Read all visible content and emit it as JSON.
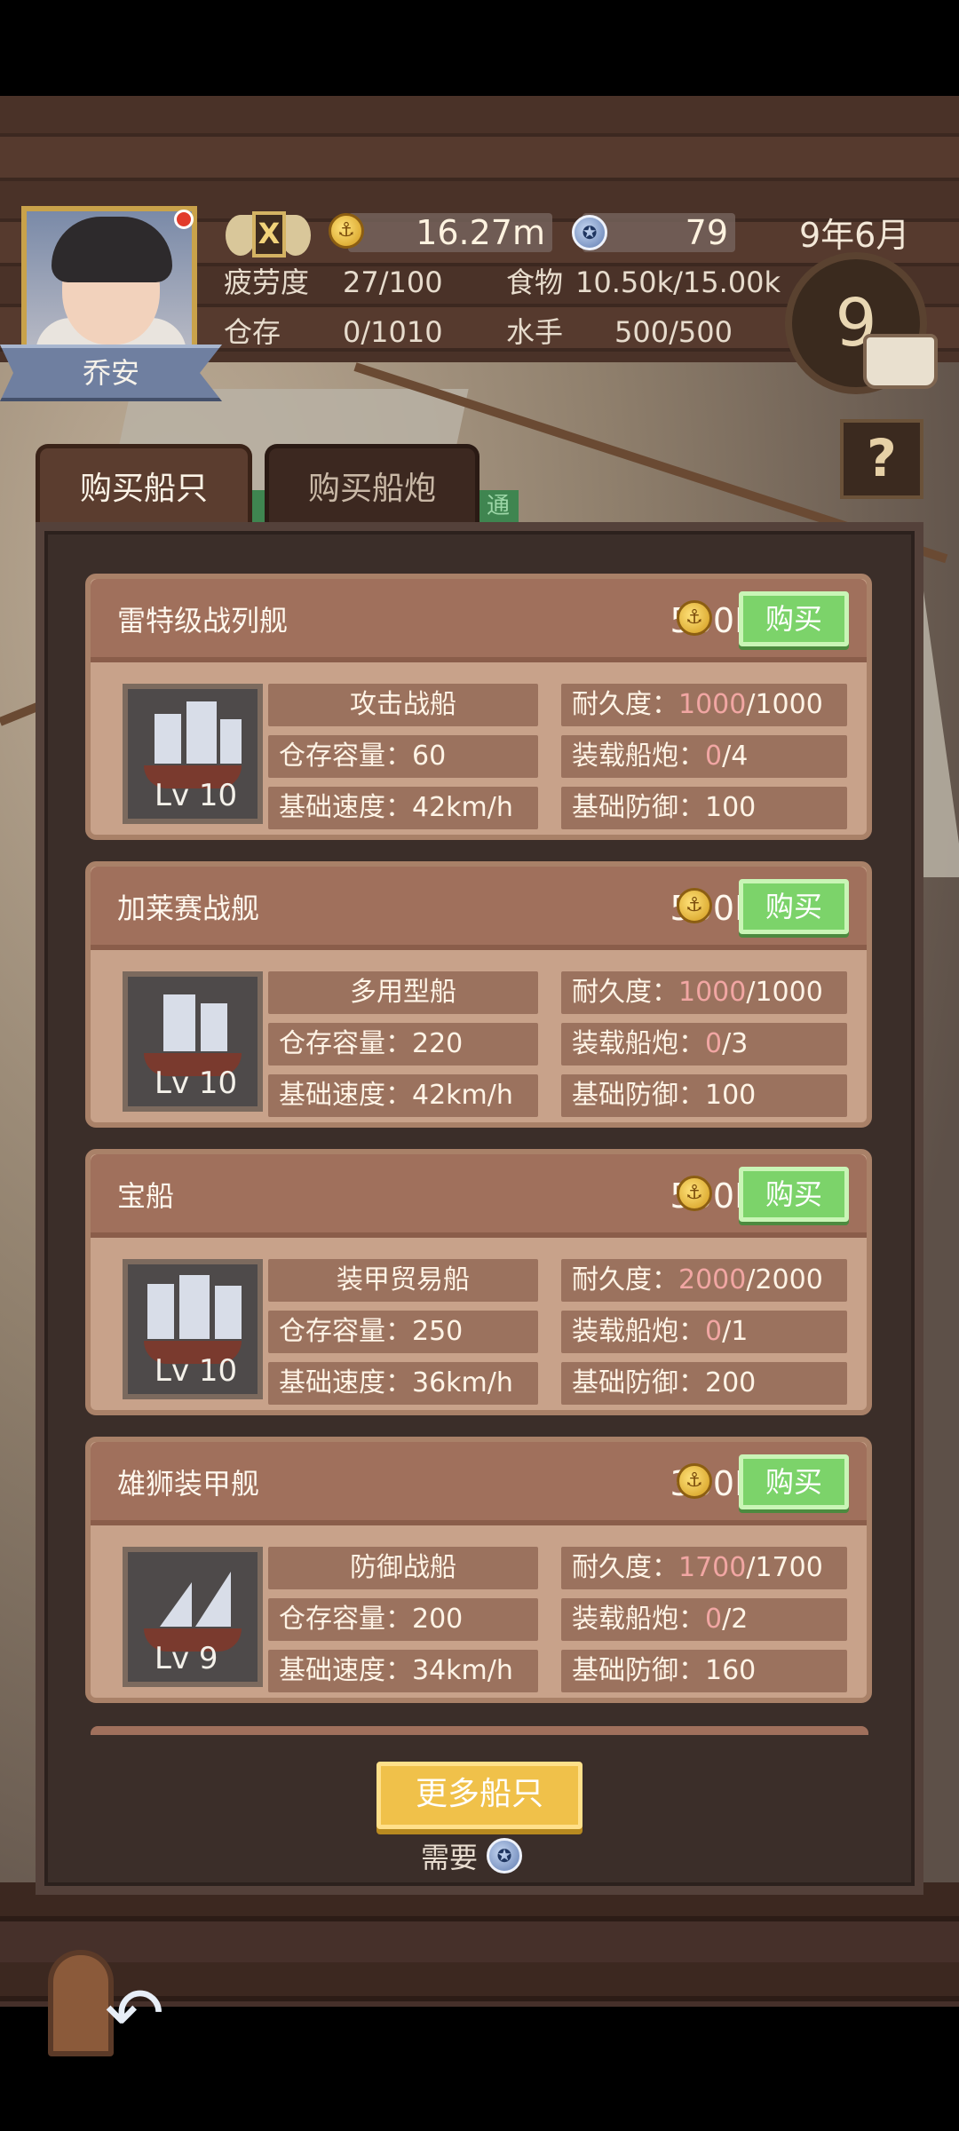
{
  "player": {
    "name": "乔安",
    "rank": "X"
  },
  "resources": {
    "gold": "16.27m",
    "medals": "79"
  },
  "stats": {
    "fatigue_label": "疲劳度",
    "fatigue_value": "27/100",
    "food_label": "食物",
    "food_value": "10.50k/15.00k",
    "storage_label": "仓存",
    "storage_value": "0/1010",
    "sailors_label": "水手",
    "sailors_value": "500/500"
  },
  "date": {
    "text": "9年6月",
    "day": "9"
  },
  "help_label": "?",
  "tabs": [
    {
      "label": "购买船只",
      "active": true
    },
    {
      "label": "购买船炮",
      "active": false
    }
  ],
  "tab_strip_text": "通",
  "ships": [
    {
      "name": "雷特级战列舰",
      "price": "500K",
      "buy_label": "购买",
      "type": "攻击战船",
      "capacity": "仓存容量：60",
      "speed": "基础速度：42km/h",
      "durability_label": "耐久度：",
      "durability_cur": "1000",
      "durability_max": "/1000",
      "guns_label": "装载船炮：",
      "guns_cur": "0",
      "guns_max": "/4",
      "defense": "基础防御：100",
      "level": "Lv 10"
    },
    {
      "name": "加莱赛战舰",
      "price": "500K",
      "buy_label": "购买",
      "type": "多用型船",
      "capacity": "仓存容量：220",
      "speed": "基础速度：42km/h",
      "durability_label": "耐久度：",
      "durability_cur": "1000",
      "durability_max": "/1000",
      "guns_label": "装载船炮：",
      "guns_cur": "0",
      "guns_max": "/3",
      "defense": "基础防御：100",
      "level": "Lv 10"
    },
    {
      "name": "宝船",
      "price": "500K",
      "buy_label": "购买",
      "type": "装甲贸易船",
      "capacity": "仓存容量：250",
      "speed": "基础速度：36km/h",
      "durability_label": "耐久度：",
      "durability_cur": "2000",
      "durability_max": "/2000",
      "guns_label": "装载船炮：",
      "guns_cur": "0",
      "guns_max": "/1",
      "defense": "基础防御：200",
      "level": "Lv 10"
    },
    {
      "name": "雄狮装甲舰",
      "price": "300K",
      "buy_label": "购买",
      "type": "防御战船",
      "capacity": "仓存容量：200",
      "speed": "基础速度：34km/h",
      "durability_label": "耐久度：",
      "durability_cur": "1700",
      "durability_max": "/1700",
      "guns_label": "装载船炮：",
      "guns_cur": "0",
      "guns_max": "/2",
      "defense": "基础防御：160",
      "level": "Lv 9"
    }
  ],
  "more_ships_label": "更多船只",
  "need_label": "需要",
  "icons": {
    "coin": "gold-coin-icon",
    "medal": "medal-icon",
    "back": "back-arrow-icon",
    "book": "book-icon"
  },
  "colors": {
    "buy_green": "#7cd36a",
    "more_gold": "#f0c14a",
    "highlight_pink": "#f1a6a3"
  }
}
